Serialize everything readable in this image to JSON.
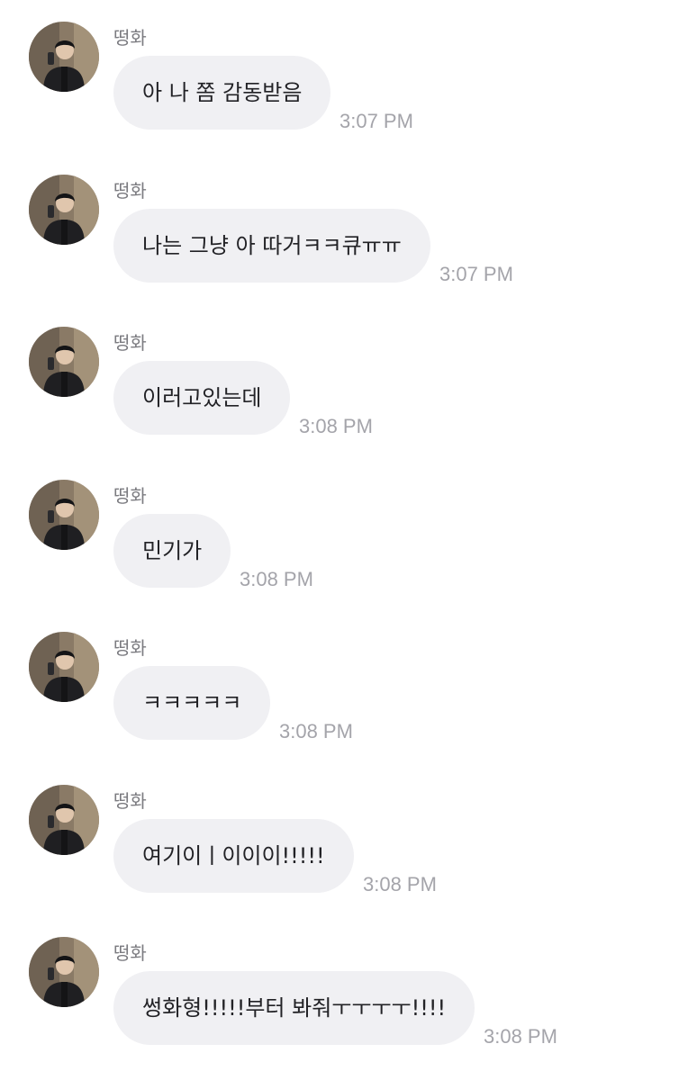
{
  "messages": [
    {
      "sender": "떵화",
      "text": "아 나 쫌 감동받음",
      "time": "3:07 PM"
    },
    {
      "sender": "떵화",
      "text": "나는 그냥 아 따거ㅋㅋ큐ㅠㅠ",
      "time": "3:07 PM"
    },
    {
      "sender": "떵화",
      "text": "이러고있는데",
      "time": "3:08 PM"
    },
    {
      "sender": "떵화",
      "text": "민기가",
      "time": "3:08 PM"
    },
    {
      "sender": "떵화",
      "text": "ㅋㅋㅋㅋㅋ",
      "time": "3:08 PM"
    },
    {
      "sender": "떵화",
      "text": "여기이ㅣ이이이!!!!!",
      "time": "3:08 PM"
    },
    {
      "sender": "떵화",
      "text": "썽화형!!!!!부터 봐줘ㅜㅜㅜㅜ!!!!",
      "time": "3:08 PM"
    }
  ],
  "avatar_icon": "user-photo-avatar",
  "colors": {
    "background": "#ffffff",
    "bubble": "#f0f0f3",
    "message_text": "#222226",
    "sender_text": "#7b7b80",
    "timestamp_text": "#a4a4aa"
  }
}
